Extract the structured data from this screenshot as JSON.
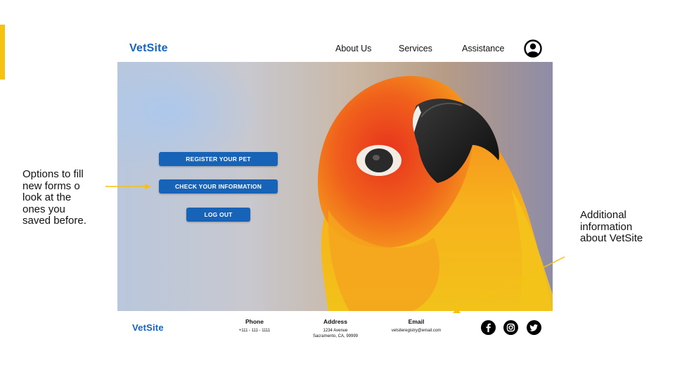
{
  "annotations": {
    "left": "Options to fill\nnew forms o\nlook at the\nones you\nsaved before.",
    "right": "Additional\ninformation\nabout VetSite"
  },
  "header": {
    "logo": "VetSite",
    "nav": [
      "About Us",
      "Services",
      "Assistance"
    ],
    "profile_icon": "user-circle-icon"
  },
  "hero": {
    "image": "orange-yellow-parrot-photo",
    "buttons": {
      "register": "REGISTER YOUR PET",
      "check_info": "CHECK YOUR INFORMATION",
      "logout": "LOG OUT"
    }
  },
  "footer": {
    "logo": "VetSite",
    "phone": {
      "label": "Phone",
      "value": "+111 - 111 - 1111"
    },
    "address": {
      "label": "Address",
      "value": "1234 Avenue\nSacramento, CA, 99999"
    },
    "email": {
      "label": "Email",
      "value": "vetsiteregistry@email.com"
    },
    "social_icons": [
      "facebook-icon",
      "instagram-icon",
      "twitter-icon"
    ]
  },
  "colors": {
    "brand_blue": "#1565c0",
    "button_blue": "#1663b8",
    "annotation_yellow": "#f5c211"
  }
}
